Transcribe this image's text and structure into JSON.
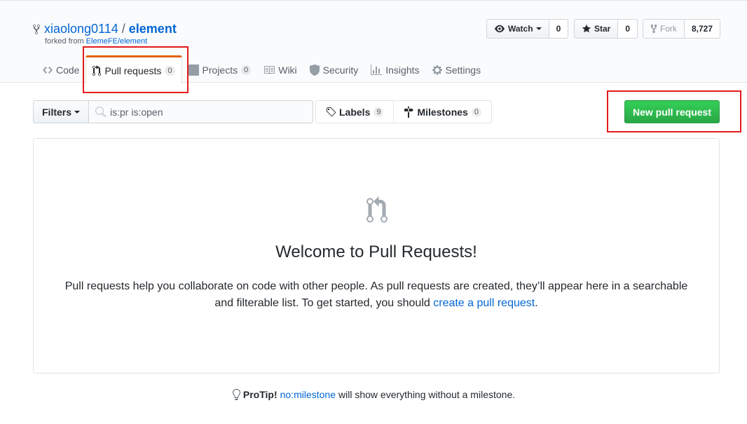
{
  "repo": {
    "owner": "xiaolong0114",
    "separator": "/",
    "name": "element",
    "forked_prefix": "forked from",
    "forked_source": "ElemeFE/element"
  },
  "actions": {
    "watch_label": "Watch",
    "watch_count": "0",
    "star_label": "Star",
    "star_count": "0",
    "fork_label": "Fork",
    "fork_count": "8,727"
  },
  "tabs": [
    {
      "label": "Code",
      "icon": "code-icon"
    },
    {
      "label": "Pull requests",
      "count": "0",
      "icon": "git-pull-request-icon",
      "selected": true
    },
    {
      "label": "Projects",
      "count": "0",
      "icon": "project-icon"
    },
    {
      "label": "Wiki",
      "icon": "book-icon"
    },
    {
      "label": "Security",
      "icon": "shield-icon"
    },
    {
      "label": "Insights",
      "icon": "graph-icon"
    },
    {
      "label": "Settings",
      "icon": "gear-icon"
    }
  ],
  "subnav": {
    "filters_label": "Filters",
    "search_value": "is:pr is:open",
    "labels_label": "Labels",
    "labels_count": "9",
    "milestones_label": "Milestones",
    "milestones_count": "0",
    "new_pr_label": "New pull request"
  },
  "blankslate": {
    "title": "Welcome to Pull Requests!",
    "text": "Pull requests help you collaborate on code with other people. As pull requests are created, they’ll appear here in a searchable and filterable list. To get started, you should",
    "link": "create a pull request",
    "end": "."
  },
  "protip": {
    "label": "ProTip!",
    "link": "no:milestone",
    "text": "will show everything without a milestone."
  },
  "colors": {
    "link": "#0366d6",
    "primary_green": "#28a745",
    "tab_accent": "#e36209",
    "highlight_red": "#e31b1b"
  }
}
